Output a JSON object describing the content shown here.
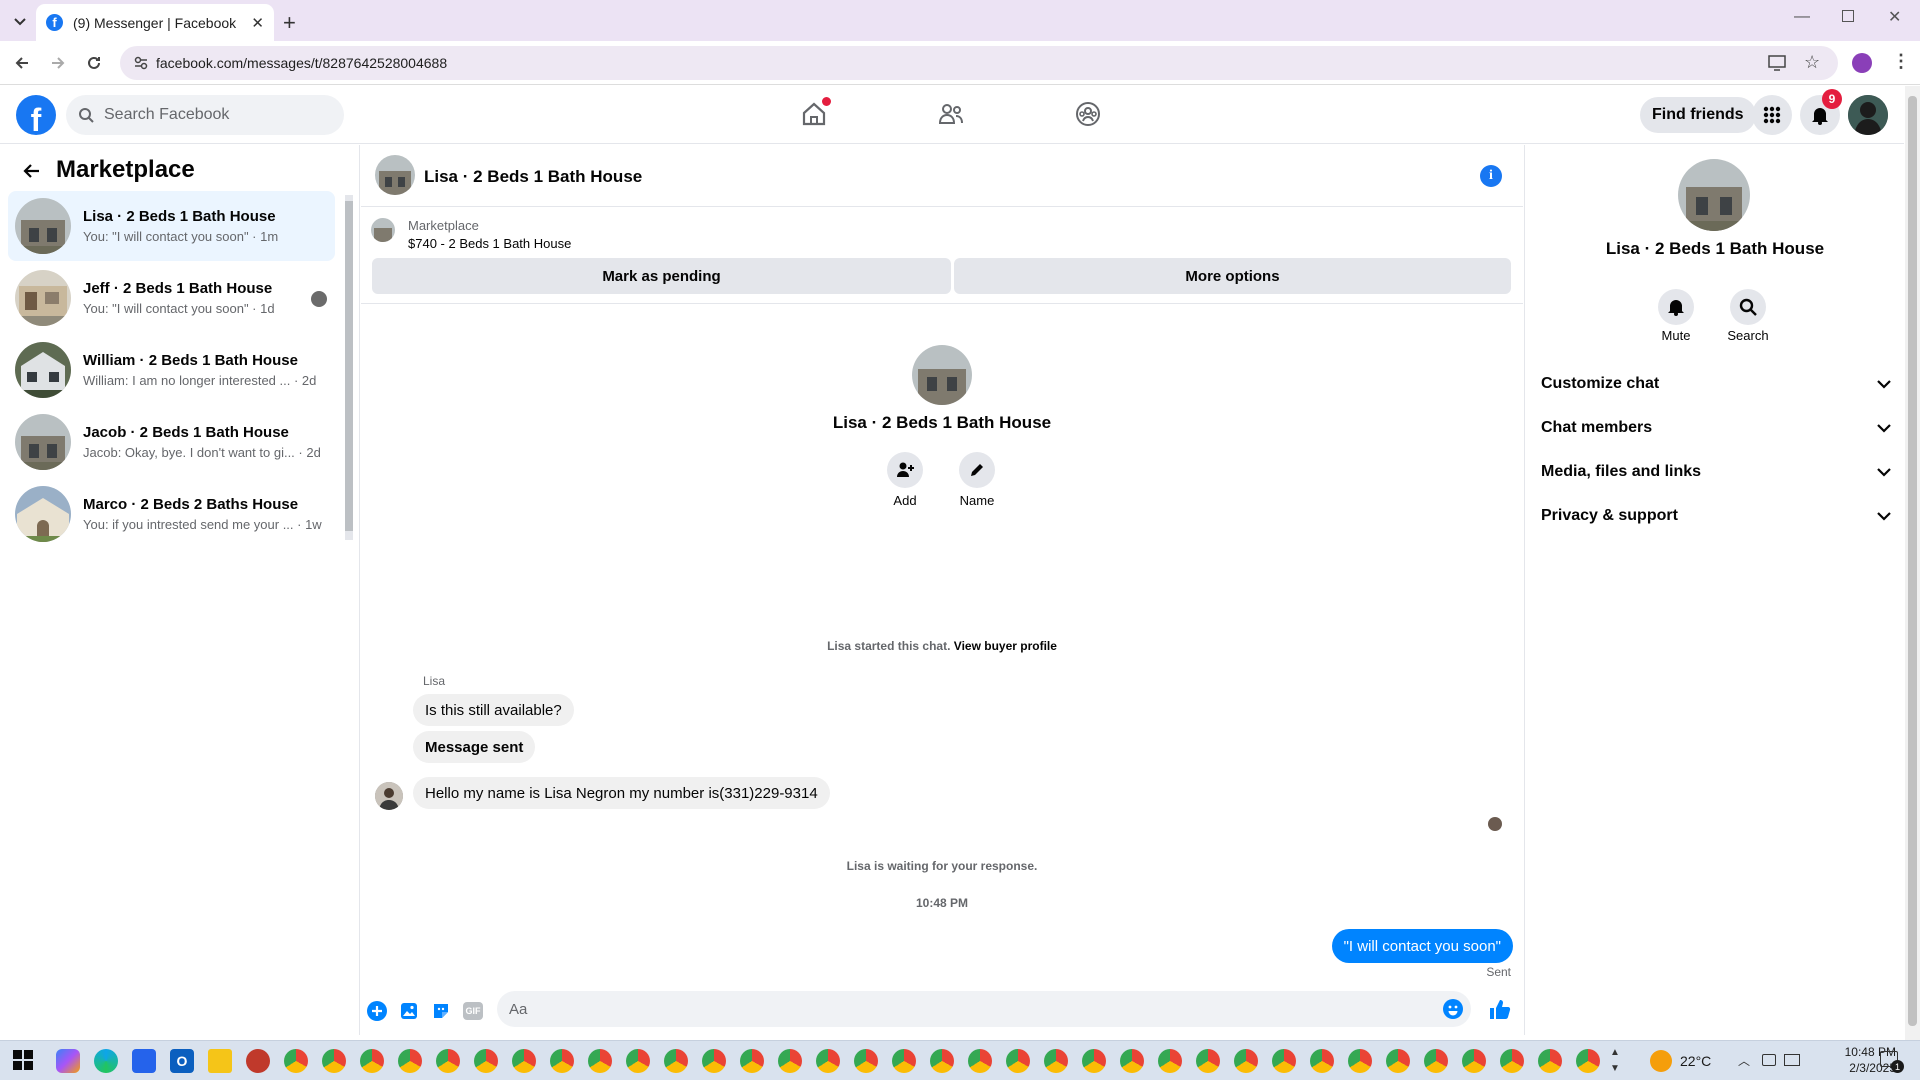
{
  "browser": {
    "tab_title": "(9) Messenger | Facebook",
    "url": "facebook.com/messages/t/8287642528004688"
  },
  "header": {
    "search_placeholder": "Search Facebook",
    "find_friends": "Find friends",
    "notif_count": "9"
  },
  "sidebar": {
    "title": "Marketplace",
    "conversations": [
      {
        "name": "Lisa · 2 Beds 1 Bath House",
        "preview": "You: \"I will contact you soon\" · 1m"
      },
      {
        "name": "Jeff · 2 Beds 1 Bath House",
        "preview": "You: \"I will contact you soon\" · 1d"
      },
      {
        "name": "William · 2 Beds 1 Bath House",
        "preview": "William: I am no longer interested ... · 2d"
      },
      {
        "name": "Jacob · 2 Beds 1 Bath House",
        "preview": "Jacob: Okay, bye. I don't want to gi... · 2d"
      },
      {
        "name": "Marco · 2 Beds 2 Baths House",
        "preview": "You: if you intrested send me your ... · 1w"
      }
    ]
  },
  "chat": {
    "title": "Lisa · 2 Beds 1 Bath House",
    "marketplace_label": "Marketplace",
    "listing": "$740 - 2 Beds 1 Bath House",
    "mark_pending": "Mark as pending",
    "more_options": "More options",
    "profile_name": "Lisa · 2 Beds 1 Bath House",
    "add_label": "Add",
    "name_label": "Name",
    "started": "Lisa started this chat.",
    "view_buyer": "View buyer profile",
    "sender": "Lisa",
    "messages": [
      "Is this still available?",
      "Message sent",
      "Hello my name is Lisa Negron my number is(331)229-9314"
    ],
    "waiting": "Lisa is waiting for your response.",
    "time": "10:48 PM",
    "my_message": "\"I will contact you soon\"",
    "sent_status": "Sent",
    "composer_placeholder": "Aa"
  },
  "details": {
    "name": "Lisa · 2 Beds 1 Bath House",
    "mute": "Mute",
    "search": "Search",
    "sections": [
      "Customize chat",
      "Chat members",
      "Media, files and links",
      "Privacy & support"
    ]
  },
  "taskbar": {
    "weather": "22°C",
    "time": "10:48 PM",
    "date": "2/3/2025",
    "notif_count": "1"
  },
  "colors": {
    "brand": "#1877f2",
    "notif": "#e41e3f",
    "selected_row": "#ebf5ff",
    "bubble_grey": "#f0f0f0"
  }
}
